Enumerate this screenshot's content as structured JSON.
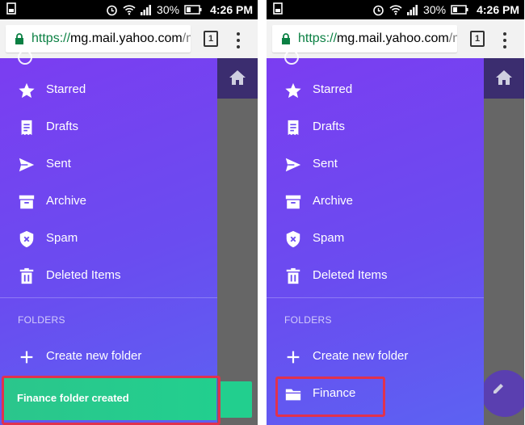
{
  "status_bar": {
    "battery": "30%",
    "time": "4:26 PM"
  },
  "browser": {
    "url_scheme": "https://",
    "url_host": "mg.mail.yahoo.com",
    "url_path": "/m/",
    "tab_count": "1"
  },
  "nav": {
    "items": [
      {
        "label": "Starred",
        "icon": "star-icon"
      },
      {
        "label": "Drafts",
        "icon": "drafts-icon"
      },
      {
        "label": "Sent",
        "icon": "send-icon"
      },
      {
        "label": "Archive",
        "icon": "archive-icon"
      },
      {
        "label": "Spam",
        "icon": "spam-shield-icon"
      },
      {
        "label": "Deleted Items",
        "icon": "trash-icon"
      }
    ]
  },
  "folders": {
    "header": "FOLDERS",
    "create_label": "Create new folder",
    "new_folder_label": "Finance"
  },
  "toast": {
    "message": "Finance folder created"
  },
  "colors": {
    "drawer_gradient_start": "#7b3df1",
    "drawer_gradient_end": "#5c62f2",
    "toast": "#22cf8e",
    "highlight": "#e0324d",
    "secure_url": "#0b8043"
  }
}
